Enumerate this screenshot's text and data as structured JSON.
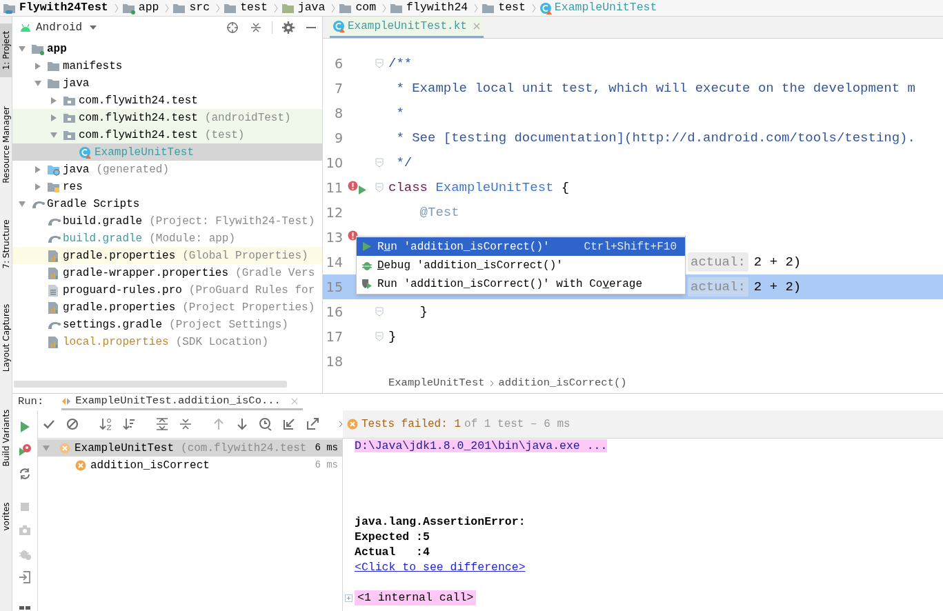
{
  "breadcrumbs": [
    {
      "label": "Flywith24Test",
      "kind": "project"
    },
    {
      "label": "app",
      "kind": "module"
    },
    {
      "label": "src",
      "kind": "folder"
    },
    {
      "label": "test",
      "kind": "folder"
    },
    {
      "label": "java",
      "kind": "test-folder"
    },
    {
      "label": "com",
      "kind": "folder"
    },
    {
      "label": "flywith24",
      "kind": "folder"
    },
    {
      "label": "test",
      "kind": "folder"
    },
    {
      "label": "ExampleUnitTest",
      "kind": "class",
      "color": "#3d9da3"
    }
  ],
  "tool_strip": [
    {
      "label": "1: Project",
      "selected": true
    },
    {
      "label": "Resource Manager",
      "selected": false
    },
    {
      "label": "7: Structure",
      "selected": false
    },
    {
      "label": "Layout Captures",
      "selected": false
    },
    {
      "label": "Build Variants",
      "selected": false
    },
    {
      "label": "vorites",
      "selected": false
    }
  ],
  "project": {
    "view": "Android",
    "tree": [
      {
        "label": "app",
        "kind": "module",
        "expanded": true,
        "selected": false,
        "children": [
          {
            "label": "manifests",
            "kind": "folder",
            "expanded": false,
            "selected": false
          },
          {
            "label": "java",
            "kind": "folder",
            "expanded": true,
            "selected": false,
            "children": [
              {
                "label": "com.flywith24.test",
                "kind": "package",
                "expanded": false,
                "selected": false
              },
              {
                "label": "com.flywith24.test",
                "hint": "(androidTest)",
                "kind": "test-package",
                "expanded": false,
                "selected": false
              },
              {
                "label": "com.flywith24.test",
                "hint": "(test)",
                "kind": "test-package",
                "expanded": true,
                "selected": false,
                "children": [
                  {
                    "label": "ExampleUnitTest",
                    "kind": "class",
                    "selected": true,
                    "color": "#3d9da3"
                  }
                ]
              }
            ]
          },
          {
            "label": "java",
            "hint": "(generated)",
            "kind": "generated",
            "expanded": false,
            "selected": false
          },
          {
            "label": "res",
            "kind": "res",
            "expanded": false,
            "selected": false
          }
        ]
      },
      {
        "label": "Gradle Scripts",
        "kind": "gradle",
        "expanded": true,
        "selected": false,
        "children": [
          {
            "label": "build.gradle",
            "hint": "(Project: Flywith24-Test)",
            "kind": "gradle",
            "selected": false
          },
          {
            "label": "build.gradle",
            "hint": "(Module: app)",
            "kind": "gradle",
            "selected": false,
            "color": "#3d9da3"
          },
          {
            "label": "gradle.properties",
            "hint": "(Global Properties)",
            "kind": "external-properties",
            "selected": false
          },
          {
            "label": "gradle-wrapper.properties",
            "hint": "(Gradle Vers",
            "kind": "properties",
            "selected": false
          },
          {
            "label": "proguard-rules.pro",
            "hint": "(ProGuard Rules for",
            "kind": "text",
            "selected": false
          },
          {
            "label": "gradle.properties",
            "hint": "(Project Properties)",
            "kind": "properties",
            "selected": false
          },
          {
            "label": "settings.gradle",
            "hint": "(Project Settings)",
            "kind": "gradle",
            "selected": false
          },
          {
            "label": "local.properties",
            "hint": "(SDK Location)",
            "kind": "properties",
            "selected": false,
            "color": "#c18a26"
          }
        ]
      }
    ]
  },
  "editor": {
    "tab": "ExampleUnitTest.kt",
    "lines": [
      {
        "number": "6",
        "fold": true,
        "current": false,
        "error": false,
        "runnable": false,
        "segments": [
          {
            "kind": "doc",
            "text": "/**"
          }
        ]
      },
      {
        "number": "7",
        "fold": false,
        "current": false,
        "error": false,
        "runnable": false,
        "segments": [
          {
            "kind": "doc",
            "text": " * Example local unit test, which will execute on the development m"
          }
        ]
      },
      {
        "number": "8",
        "fold": false,
        "current": false,
        "error": false,
        "runnable": false,
        "segments": [
          {
            "kind": "doc",
            "text": " *"
          }
        ]
      },
      {
        "number": "9",
        "fold": false,
        "current": false,
        "error": false,
        "runnable": false,
        "segments": [
          {
            "kind": "doc",
            "text": " * See [testing documentation](http://d.android.com/tools/testing)."
          }
        ]
      },
      {
        "number": "10",
        "fold": true,
        "current": false,
        "error": false,
        "runnable": false,
        "segments": [
          {
            "kind": "doc",
            "text": " */"
          }
        ]
      },
      {
        "number": "11",
        "fold": true,
        "current": false,
        "error": true,
        "runnable": true,
        "segments": [
          {
            "kind": "keyword",
            "text": "class"
          },
          {
            "kind": "type",
            "text": " ExampleUnitTest"
          },
          {
            "kind": "plain",
            "text": " {"
          }
        ]
      },
      {
        "number": "12",
        "fold": false,
        "current": false,
        "error": false,
        "runnable": false,
        "segments": [
          {
            "kind": "annotation",
            "text": "    @Test"
          }
        ]
      },
      {
        "number": "13",
        "current": false,
        "error": true,
        "runnable": false
      },
      {
        "number": "14",
        "current": false,
        "error": false,
        "runnable": false,
        "tail": true,
        "segments": [
          {
            "kind": "hint",
            "text": "actual:"
          },
          {
            "kind": "plain",
            "text": "2 + 2)"
          }
        ]
      },
      {
        "number": "15",
        "current": true,
        "error": false,
        "runnable": false,
        "tail": true,
        "segments": [
          {
            "kind": "hint",
            "text": "actual:"
          },
          {
            "kind": "plain",
            "text": "2 + 2)"
          }
        ]
      },
      {
        "number": "16",
        "fold": true,
        "current": false,
        "error": false,
        "runnable": false,
        "segments": [
          {
            "kind": "plain",
            "text": "    }"
          }
        ]
      },
      {
        "number": "17",
        "fold": true,
        "current": false,
        "error": false,
        "runnable": false,
        "segments": [
          {
            "kind": "plain",
            "text": "}"
          }
        ]
      },
      {
        "number": "18",
        "fold": false,
        "current": false,
        "error": false,
        "runnable": false
      }
    ],
    "popup": [
      {
        "kind": "run",
        "before": "R",
        "mnemonic": "u",
        "after": "n 'addition_isCorrect()'",
        "shortcut": "Ctrl+Shift+F10",
        "selected": true
      },
      {
        "kind": "debug",
        "mnemonic": "D",
        "after": "ebug 'addition_isCorrect()'",
        "selected": false
      },
      {
        "kind": "coverage",
        "before": "Run 'addition_isCorrect()' with Co",
        "mnemonic": "v",
        "after": "erage",
        "selected": false
      }
    ],
    "breadcrumbs": [
      "ExampleUnitTest",
      "addition_isCorrect()"
    ]
  },
  "run": {
    "title": "Run:",
    "tab": "ExampleUnitTest.addition_isCo...",
    "status": {
      "failed": "Tests failed: 1",
      "summary": "of 1 test – 6 ms"
    },
    "tests": [
      {
        "label": "ExampleUnitTest",
        "hint": "(com.flywith24.test",
        "time": "6 ms",
        "selected": true,
        "expanded": true,
        "children": [
          {
            "label": "addition_isCorrect",
            "time": "6 ms",
            "selected": false
          }
        ]
      }
    ],
    "console": {
      "command": "D:\\Java\\jdk1.8.0_201\\bin\\java.exe ...",
      "output": [
        "java.lang.AssertionError:",
        "Expected :5",
        "Actual   :4"
      ],
      "diff_link": "<Click to see difference>",
      "folded": "<1 internal call>"
    }
  }
}
